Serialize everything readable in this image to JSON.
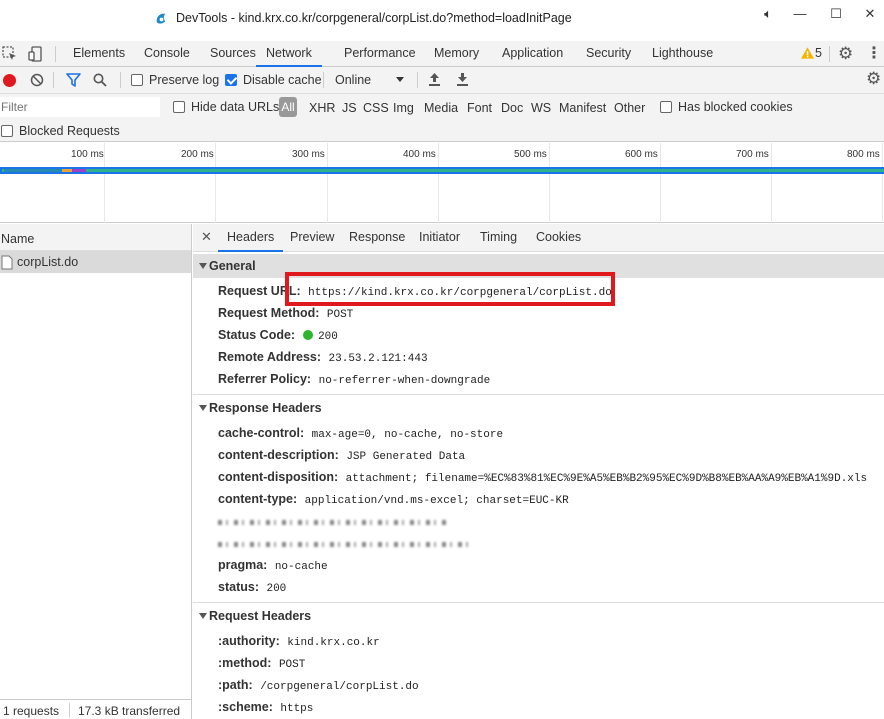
{
  "window": {
    "title": "DevTools - kind.krx.co.kr/corpgeneral/corpList.do?method=loadInitPage"
  },
  "tabs": [
    "Elements",
    "Console",
    "Sources",
    "Network",
    "Performance",
    "Memory",
    "Application",
    "Security",
    "Lighthouse"
  ],
  "active_tab": "Network",
  "warnings_count": "5",
  "toolbar": {
    "preserve_log": "Preserve log",
    "disable_cache": "Disable cache",
    "throttle": "Online"
  },
  "filter": {
    "placeholder": "Filter",
    "hide_data_urls": "Hide data URLs",
    "types": [
      "All",
      "XHR",
      "JS",
      "CSS",
      "Img",
      "Media",
      "Font",
      "Doc",
      "WS",
      "Manifest",
      "Other"
    ],
    "has_blocked_cookies": "Has blocked cookies",
    "blocked_requests": "Blocked Requests"
  },
  "timeline": {
    "ticks": [
      "100 ms",
      "200 ms",
      "300 ms",
      "400 ms",
      "500 ms",
      "600 ms",
      "700 ms",
      "800 ms"
    ]
  },
  "request_list": {
    "header": "Name",
    "rows": [
      "corpList.do"
    ],
    "status": {
      "requests": "1 requests",
      "transferred": "17.3 kB transferred"
    }
  },
  "detail_tabs": [
    "Headers",
    "Preview",
    "Response",
    "Initiator",
    "Timing",
    "Cookies"
  ],
  "general": {
    "title": "General",
    "request_url_key": "Request URL:",
    "request_url": "https://kind.krx.co.kr/corpgeneral/corpList.do",
    "request_method_key": "Request Method:",
    "request_method": "POST",
    "status_code_key": "Status Code:",
    "status_code": "200",
    "remote_address_key": "Remote Address:",
    "remote_address": "23.53.2.121:443",
    "referrer_policy_key": "Referrer Policy:",
    "referrer_policy": "no-referrer-when-downgrade"
  },
  "response_headers": {
    "title": "Response Headers",
    "items": [
      {
        "key": "cache-control:",
        "value": "max-age=0, no-cache, no-store"
      },
      {
        "key": "content-description:",
        "value": "JSP Generated Data"
      },
      {
        "key": "content-disposition:",
        "value": "attachment; filename=%EC%83%81%EC%9E%A5%EB%B2%95%EC%9D%B8%EB%AA%A9%EB%A1%9D.xls"
      },
      {
        "key": "content-type:",
        "value": "application/vnd.ms-excel; charset=EUC-KR"
      },
      {
        "key": "pragma:",
        "value": "no-cache"
      },
      {
        "key": "status:",
        "value": "200"
      }
    ]
  },
  "request_headers": {
    "title": "Request Headers",
    "items": [
      {
        "key": ":authority:",
        "value": "kind.krx.co.kr"
      },
      {
        "key": ":method:",
        "value": "POST"
      },
      {
        "key": ":path:",
        "value": "/corpgeneral/corpList.do"
      },
      {
        "key": ":scheme:",
        "value": "https"
      }
    ]
  },
  "colors": {
    "accent": "#1a73e8",
    "highlight_box": "#e0191f",
    "status_ok": "#2db52d",
    "record": "#e0191f"
  }
}
